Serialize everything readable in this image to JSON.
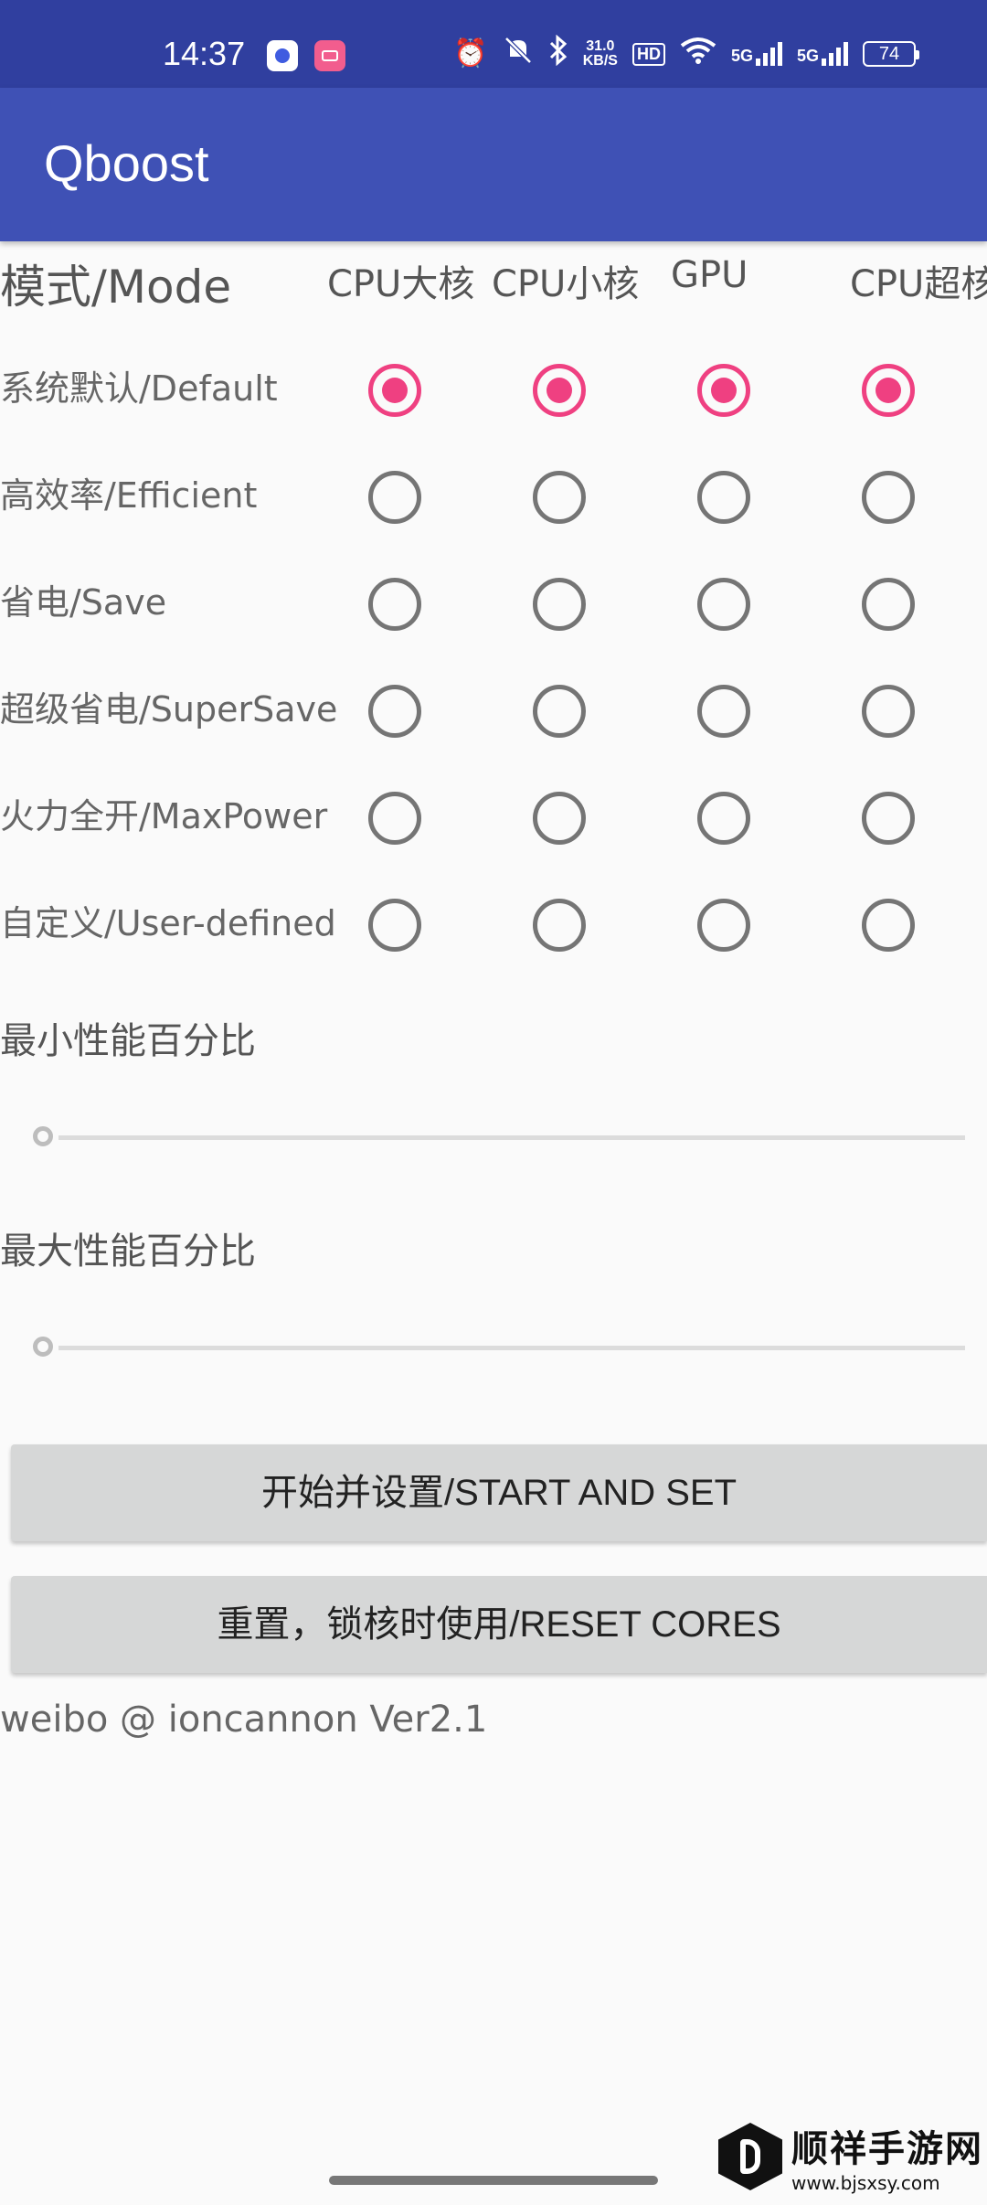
{
  "status_bar": {
    "time": "14:37",
    "net_speed_value": "31.0",
    "net_speed_unit": "KB/S",
    "hd_label": "HD",
    "sig1": "5G",
    "sig2": "5G",
    "battery": "74",
    "icons": [
      "baidu-app-icon",
      "bilibili-app-icon",
      "alarm-icon",
      "mute-icon",
      "bluetooth-icon",
      "wifi-icon",
      "signal-icon",
      "battery-icon"
    ]
  },
  "app_bar": {
    "title": "Qboost"
  },
  "grid": {
    "mode_header": "模式/Mode",
    "columns": [
      "CPU大核",
      "CPU小核",
      "GPU",
      "CPU超核"
    ],
    "rows": [
      {
        "label": "系统默认/Default",
        "selected": true
      },
      {
        "label": "高效率/Efficient",
        "selected": false
      },
      {
        "label": "省电/Save",
        "selected": false
      },
      {
        "label": "超级省电/SuperSave",
        "selected": false
      },
      {
        "label": "火力全开/MaxPower",
        "selected": false
      },
      {
        "label": "自定义/User-defined",
        "selected": false
      }
    ]
  },
  "sliders": {
    "min_label": "最小性能百分比",
    "min_value": 0,
    "max_label": "最大性能百分比",
    "max_value": 0
  },
  "buttons": {
    "start": "开始并设置/START AND SET",
    "reset": "重置，锁核时使用/RESET CORES"
  },
  "footer": "weibo @ ioncannon Ver2.1",
  "watermark": {
    "name": "顺祥手游网",
    "url": "www.bjsxsy.com"
  },
  "colors": {
    "accent": "#ef4081",
    "app_bar": "#3f51b5",
    "status_bar": "#303f9f"
  }
}
